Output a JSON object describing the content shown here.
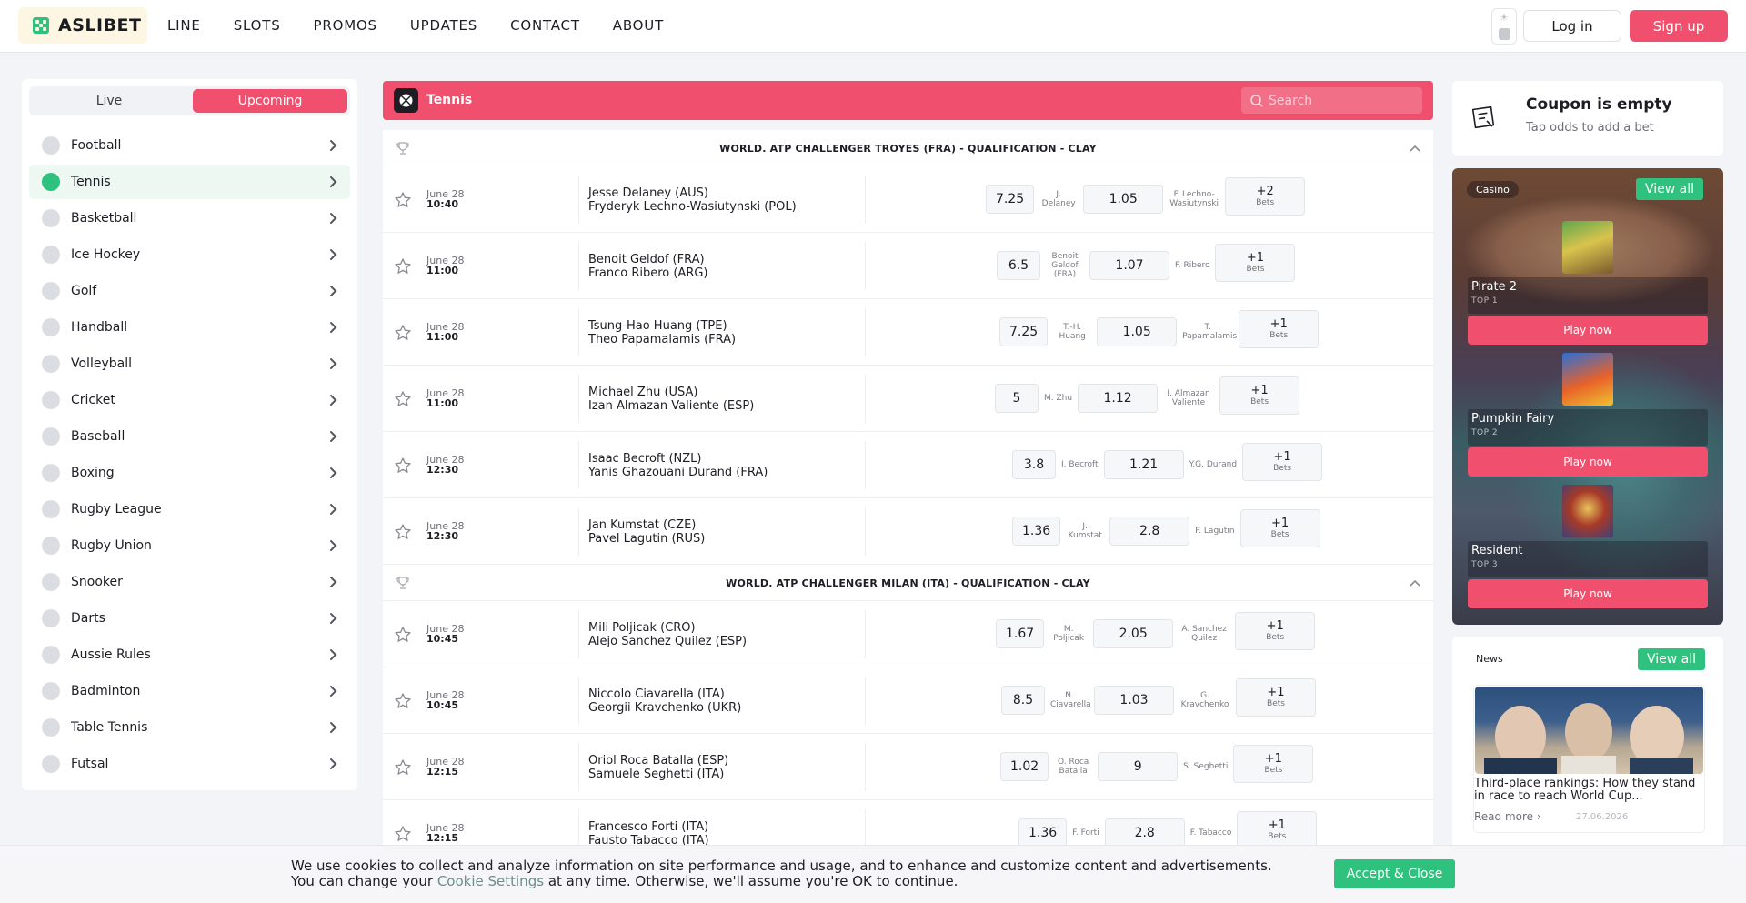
{
  "header": {
    "logo": "ASLIBET",
    "nav": [
      "LINE",
      "SLOTS",
      "PROMOS",
      "UPDATES",
      "CONTACT",
      "ABOUT"
    ],
    "login": "Log in",
    "signup": "Sign up"
  },
  "sidebar": {
    "tabs": {
      "live": "Live",
      "upcoming": "Upcoming"
    },
    "active_tab": "Upcoming",
    "items": [
      {
        "label": "Football",
        "icon": "football-icon"
      },
      {
        "label": "Tennis",
        "icon": "tennis-icon",
        "active": true
      },
      {
        "label": "Basketball",
        "icon": "basketball-icon"
      },
      {
        "label": "Ice Hockey",
        "icon": "ice-hockey-icon"
      },
      {
        "label": "Golf",
        "icon": "golf-icon"
      },
      {
        "label": "Handball",
        "icon": "handball-icon"
      },
      {
        "label": "Volleyball",
        "icon": "volleyball-icon"
      },
      {
        "label": "Cricket",
        "icon": "cricket-icon"
      },
      {
        "label": "Baseball",
        "icon": "baseball-icon"
      },
      {
        "label": "Boxing",
        "icon": "boxing-icon"
      },
      {
        "label": "Rugby League",
        "icon": "rugby-league-icon"
      },
      {
        "label": "Rugby Union",
        "icon": "rugby-union-icon"
      },
      {
        "label": "Snooker",
        "icon": "snooker-icon"
      },
      {
        "label": "Darts",
        "icon": "darts-icon"
      },
      {
        "label": "Aussie Rules",
        "icon": "aussie-rules-icon"
      },
      {
        "label": "Badminton",
        "icon": "badminton-icon"
      },
      {
        "label": "Table Tennis",
        "icon": "table-tennis-icon"
      },
      {
        "label": "Futsal",
        "icon": "futsal-icon"
      }
    ]
  },
  "main": {
    "title": "Tennis",
    "search_placeholder": "Search",
    "leagues": [
      {
        "title": "WORLD. ATP CHALLENGER TROYES (FRA) - QUALIFICATION - CLAY",
        "events": [
          {
            "date": "June 28",
            "time": "10:40",
            "home": "Jesse Delaney (AUS)",
            "away": "Fryderyk Lechno-Wasiutynski (POL)",
            "odd1": "7.25",
            "lbl1": "J. Delaney",
            "odd2": "1.05",
            "lbl2": "F. Lechno-Wasiutynski",
            "more": "+2",
            "bets": "Bets"
          },
          {
            "date": "June 28",
            "time": "11:00",
            "home": "Benoit Geldof (FRA)",
            "away": "Franco Ribero (ARG)",
            "odd1": "6.5",
            "lbl1": "Benoit Geldof (FRA)",
            "odd2": "1.07",
            "lbl2": "F. Ribero",
            "more": "+1",
            "bets": "Bets"
          },
          {
            "date": "June 28",
            "time": "11:00",
            "home": "Tsung-Hao Huang (TPE)",
            "away": "Theo Papamalamis (FRA)",
            "odd1": "7.25",
            "lbl1": "T.-H. Huang",
            "odd2": "1.05",
            "lbl2": "T. Papamalamis",
            "more": "+1",
            "bets": "Bets"
          },
          {
            "date": "June 28",
            "time": "11:00",
            "home": "Michael Zhu (USA)",
            "away": "Izan Almazan Valiente (ESP)",
            "odd1": "5",
            "lbl1": "M. Zhu",
            "odd2": "1.12",
            "lbl2": "I. Almazan Valiente",
            "more": "+1",
            "bets": "Bets"
          },
          {
            "date": "June 28",
            "time": "12:30",
            "home": "Isaac Becroft (NZL)",
            "away": "Yanis Ghazouani Durand (FRA)",
            "odd1": "3.8",
            "lbl1": "I. Becroft",
            "odd2": "1.21",
            "lbl2": "Y.G. Durand",
            "more": "+1",
            "bets": "Bets"
          },
          {
            "date": "June 28",
            "time": "12:30",
            "home": "Jan Kumstat (CZE)",
            "away": "Pavel Lagutin (RUS)",
            "odd1": "1.36",
            "lbl1": "J. Kumstat",
            "odd2": "2.8",
            "lbl2": "P. Lagutin",
            "more": "+1",
            "bets": "Bets"
          }
        ]
      },
      {
        "title": "WORLD. ATP CHALLENGER MILAN (ITA) - QUALIFICATION - CLAY",
        "events": [
          {
            "date": "June 28",
            "time": "10:45",
            "home": "Mili Poljicak (CRO)",
            "away": "Alejo Sanchez Quilez (ESP)",
            "odd1": "1.67",
            "lbl1": "M. Poljicak",
            "odd2": "2.05",
            "lbl2": "A. Sanchez Quilez",
            "more": "+1",
            "bets": "Bets"
          },
          {
            "date": "June 28",
            "time": "10:45",
            "home": "Niccolo Ciavarella (ITA)",
            "away": "Georgii Kravchenko (UKR)",
            "odd1": "8.5",
            "lbl1": "N. Ciavarella",
            "odd2": "1.03",
            "lbl2": "G. Kravchenko",
            "more": "+1",
            "bets": "Bets"
          },
          {
            "date": "June 28",
            "time": "12:15",
            "home": "Oriol Roca Batalla (ESP)",
            "away": "Samuele Seghetti (ITA)",
            "odd1": "1.02",
            "lbl1": "O. Roca Batalla",
            "odd2": "9",
            "lbl2": "S. Seghetti",
            "more": "+1",
            "bets": "Bets"
          },
          {
            "date": "June 28",
            "time": "12:15",
            "home": "Francesco Forti (ITA)",
            "away": "Fausto Tabacco (ITA)",
            "odd1": "1.36",
            "lbl1": "F. Forti",
            "odd2": "2.8",
            "lbl2": "F. Tabacco",
            "more": "+1",
            "bets": "Bets"
          }
        ]
      }
    ]
  },
  "coupon": {
    "title": "Coupon is empty",
    "subtitle": "Tap odds to add a bet"
  },
  "casino": {
    "tag": "Casino",
    "view_all": "View all",
    "games": [
      {
        "name": "Pirate 2",
        "rank": "TOP 1",
        "play": "Play now"
      },
      {
        "name": "Pumpkin Fairy",
        "rank": "TOP 2",
        "play": "Play now"
      },
      {
        "name": "Resident",
        "rank": "TOP 3",
        "play": "Play now"
      }
    ]
  },
  "news": {
    "title": "News",
    "view_all": "View all",
    "headline": "Third-place rankings: How they stand in race to reach World Cup...",
    "read_more": "Read more",
    "date": "27.06.2026"
  },
  "cookie": {
    "line1": "We use cookies to collect and analyze information on site performance and usage, and to enhance and customize content and advertisements.",
    "pre": "You can change your",
    "link": "Cookie Settings",
    "post": "at any time. Otherwise, we'll assume you're OK to continue.",
    "accept": "Accept & Close"
  },
  "colors": {
    "accent": "#f0506e",
    "green": "#2ec27e",
    "dark": "#1d1d24"
  }
}
